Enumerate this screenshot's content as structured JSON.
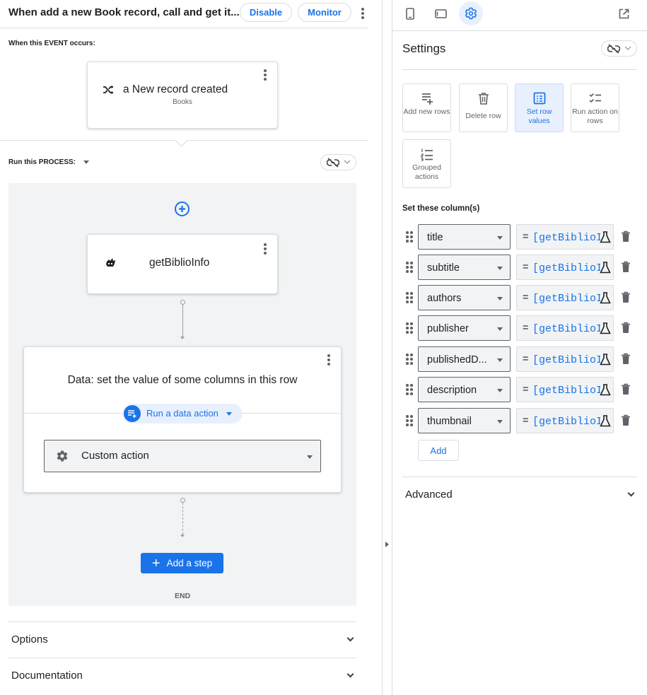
{
  "header": {
    "bot_title": "When add a new Book record, call and get it...",
    "disable_label": "Disable",
    "monitor_label": "Monitor"
  },
  "event": {
    "section_label": "When this EVENT occurs:",
    "title": "a New record created",
    "table": "Books"
  },
  "process": {
    "section_label": "Run this PROCESS:",
    "bp_title": "getBiblioInfo",
    "step_title": "Data: set the value of some columns in this row",
    "step_type_label": "Run a data action",
    "action_select_value": "Custom action",
    "add_step_label": "Add a step",
    "end_label": "END"
  },
  "expanders": {
    "options": "Options",
    "documentation": "Documentation"
  },
  "settings": {
    "title": "Settings",
    "actions": [
      {
        "label": "Add new rows",
        "icon": "add-rows-icon",
        "selected": false
      },
      {
        "label": "Delete row",
        "icon": "trash-icon",
        "selected": false
      },
      {
        "label": "Set row values",
        "icon": "set-values-icon",
        "selected": true
      },
      {
        "label": "Run action on rows",
        "icon": "checklist-icon",
        "selected": false
      },
      {
        "label": "Grouped actions",
        "icon": "numbered-list-icon",
        "selected": false
      }
    ],
    "columns_label": "Set these column(s)",
    "columns": [
      {
        "column": "title",
        "expression": "[getBiblioInfo]"
      },
      {
        "column": "subtitle",
        "expression": "[getBiblioInfo]"
      },
      {
        "column": "authors",
        "expression": "[getBiblioInfo]"
      },
      {
        "column": "publisher",
        "expression": "[getBiblioInfo]"
      },
      {
        "column": "publishedD...",
        "expression": "[getBiblioInfo]"
      },
      {
        "column": "description",
        "expression": "[getBiblioInfo]"
      },
      {
        "column": "thumbnail",
        "expression": "[getBiblioInfo]"
      }
    ],
    "eq_sign": "=",
    "add_label": "Add",
    "advanced_label": "Advanced"
  },
  "colors": {
    "accent": "#1a73e8",
    "accent_bg": "#e8f0fe",
    "border": "#dadce0",
    "field_bg": "#f1f3f4"
  }
}
